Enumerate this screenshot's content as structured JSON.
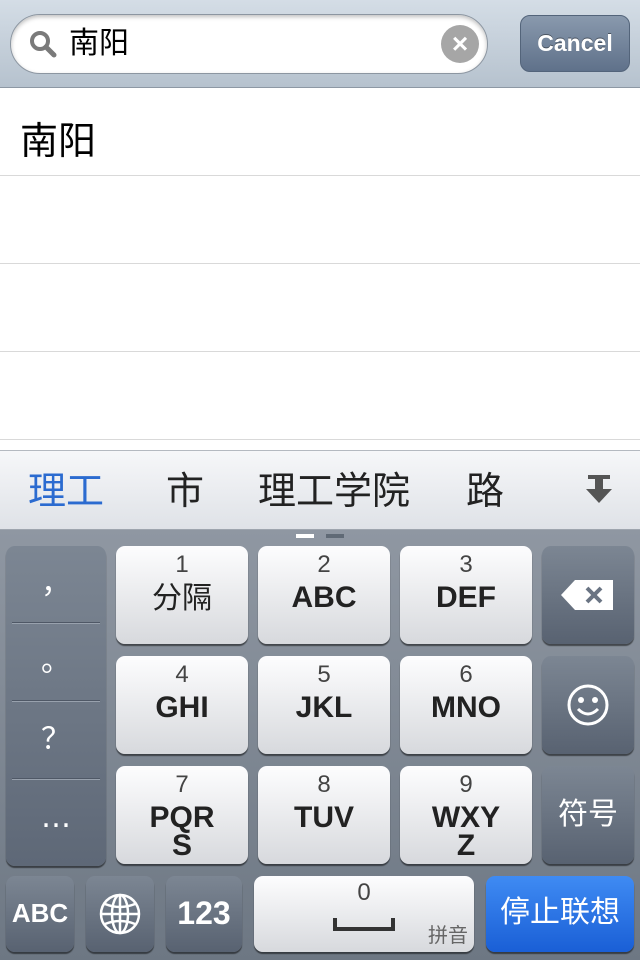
{
  "search": {
    "query": "南阳",
    "cancel_label": "Cancel"
  },
  "results": [
    "南阳",
    "",
    "",
    ""
  ],
  "candidates": [
    "理工",
    "市",
    "理工学院",
    "路"
  ],
  "keyboard": {
    "punctuation": [
      "，",
      "。",
      "？",
      "…"
    ],
    "keys": [
      {
        "num": "1",
        "label": "分隔"
      },
      {
        "num": "2",
        "label": "ABC"
      },
      {
        "num": "3",
        "label": "DEF"
      },
      {
        "num": "4",
        "label": "GHI"
      },
      {
        "num": "5",
        "label": "JKL"
      },
      {
        "num": "6",
        "label": "MNO"
      },
      {
        "num": "7",
        "label": "PQR S"
      },
      {
        "num": "8",
        "label": "TUV"
      },
      {
        "num": "9",
        "label": "WXY Z"
      }
    ],
    "symbol_label": "符号",
    "abc_label": "ABC",
    "num_label": "123",
    "space_num": "0",
    "space_hint": "拼音",
    "go_label": "停止联想"
  },
  "colors": {
    "accent": "#2b6bd0",
    "go_key": "#2a72e6"
  }
}
